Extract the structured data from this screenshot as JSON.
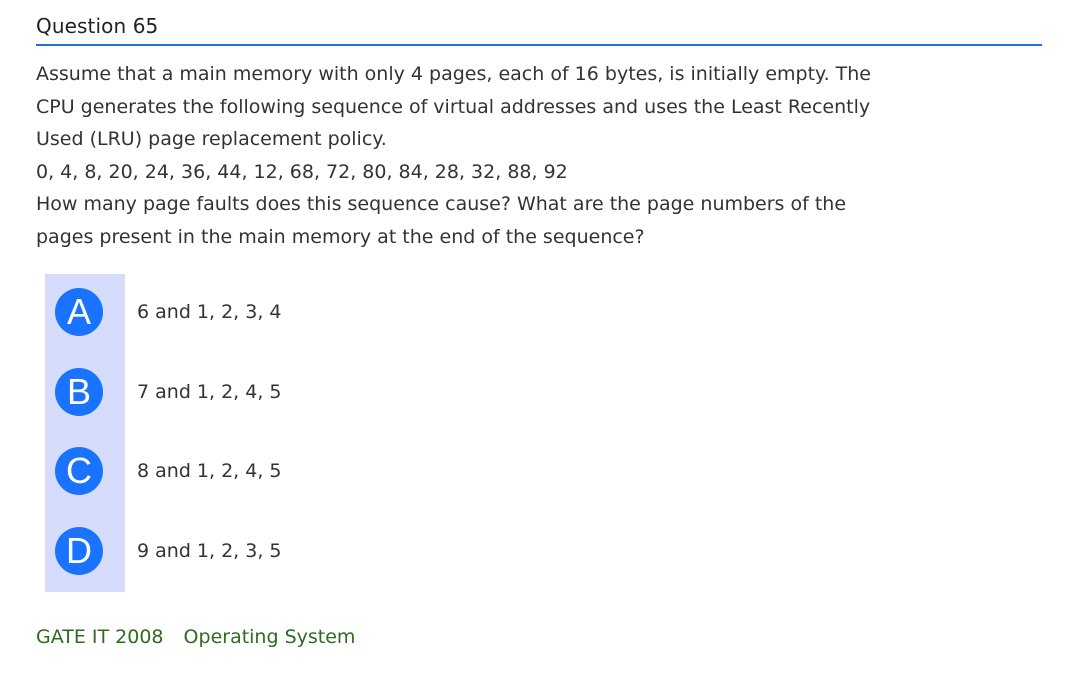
{
  "question": {
    "title": "Question 65",
    "lines": [
      "Assume that a main memory with only 4 pages, each of 16 bytes, is initially empty. The",
      "CPU generates the following sequence of virtual addresses and uses the Least Recently",
      "Used (LRU) page replacement policy.",
      "0, 4, 8, 20, 24, 36, 44, 12, 68, 72, 80, 84, 28, 32, 88, 92",
      "How many page faults does this sequence cause? What are the page numbers of the",
      "pages present in the main memory at the end of the sequence?"
    ]
  },
  "options": [
    {
      "letter": "A",
      "text": "6 and 1, 2, 3, 4"
    },
    {
      "letter": "B",
      "text": "7 and 1, 2, 4, 5"
    },
    {
      "letter": "C",
      "text": "8 and 1, 2, 4, 5"
    },
    {
      "letter": "D",
      "text": "9 and 1, 2, 3, 5"
    }
  ],
  "tags": [
    "GATE IT 2008",
    "Operating System"
  ],
  "colors": {
    "accent": "#1a73e8",
    "option_circle": "#1a73ff",
    "option_strip": "#d6dcfb",
    "tag_text": "#2e6b1f"
  }
}
